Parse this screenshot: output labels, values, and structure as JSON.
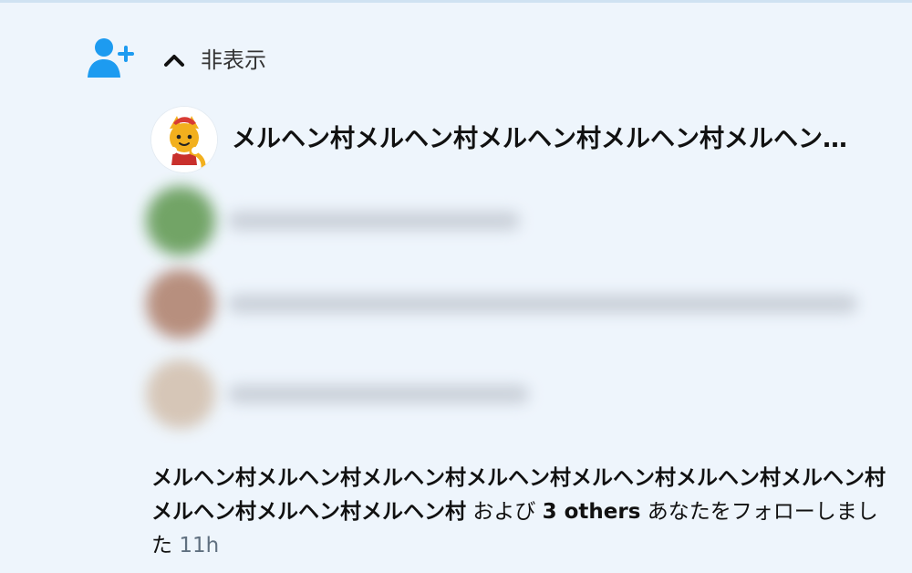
{
  "notification": {
    "hide_label": "非表示",
    "follower_name": "メルヘン村メルヘン村メルヘン村メルヘン村メルヘン…",
    "message": {
      "name": "メルヘン村メルヘン村メルヘン村メルヘン村メルヘン村メルヘン村メルヘン村メルヘン村メルヘン村メルヘン村",
      "and": "および",
      "others": "3 others",
      "action": "あなたをフォローしました",
      "time": "11h"
    }
  },
  "colors": {
    "accent": "#1d9bf0",
    "background": "#eef5fc",
    "text": "#111111",
    "muted": "#607080"
  },
  "icons": {
    "follow": "user-plus-icon",
    "toggle": "chevron-up-icon",
    "avatar": "cartoon-mascot-avatar"
  }
}
